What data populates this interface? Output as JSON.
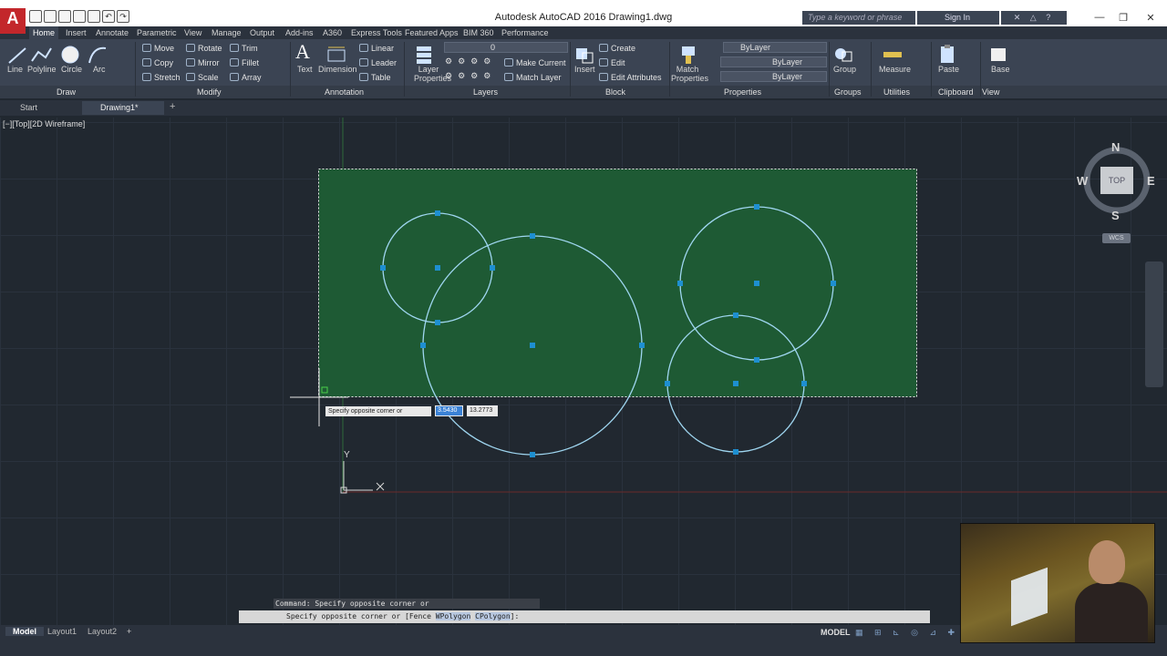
{
  "app": {
    "logo": "A",
    "title": "Autodesk AutoCAD 2016    Drawing1.dwg",
    "search_placeholder": "Type a keyword or phrase",
    "signin": "Sign In"
  },
  "menu_tabs": [
    "Home",
    "Insert",
    "Annotate",
    "Parametric",
    "View",
    "Manage",
    "Output",
    "Add-ins",
    "A360",
    "Express Tools",
    "Featured Apps",
    "BIM 360",
    "Performance"
  ],
  "ribbon": {
    "draw": {
      "title": "Draw",
      "tools": [
        "Line",
        "Polyline",
        "Circle",
        "Arc"
      ]
    },
    "modify": {
      "title": "Modify",
      "tools": [
        "Move",
        "Rotate",
        "Trim",
        "Copy",
        "Mirror",
        "Fillet",
        "Stretch",
        "Scale",
        "Array"
      ]
    },
    "annotation": {
      "title": "Annotation",
      "tools": [
        "Text",
        "Dimension",
        "Linear",
        "Leader",
        "Table"
      ]
    },
    "layers": {
      "title": "Layers",
      "big": "Layer Properties",
      "current_layer": "0",
      "tools": [
        "Make Current",
        "Match Layer"
      ]
    },
    "block": {
      "title": "Block",
      "big": "Insert",
      "tools": [
        "Create",
        "Edit",
        "Edit Attributes"
      ]
    },
    "properties": {
      "title": "Properties",
      "big": "Match Properties",
      "color": "ByLayer",
      "linetype": "ByLayer",
      "lineweight": "ByLayer"
    },
    "groups": {
      "title": "Groups",
      "big": "Group"
    },
    "utilities": {
      "title": "Utilities",
      "big": "Measure"
    },
    "clipboard": {
      "title": "Clipboard",
      "big": "Paste"
    },
    "view": {
      "title": "View",
      "big": "Base"
    }
  },
  "file_tabs": [
    "Start",
    "Drawing1*"
  ],
  "viewport_label": "[−][Top][2D Wireframe]",
  "viewcube": {
    "top": "TOP",
    "n": "N",
    "s": "S",
    "e": "E",
    "w": "W",
    "wcs": "WCS"
  },
  "tooltip": {
    "prompt": "Specify opposite corner or",
    "x_value": "3.5430",
    "y_value": "13.2773"
  },
  "command": {
    "history": "Command: Specify opposite corner or [Fence/WPolygon/CPolygon]:",
    "prompt_prefix": "Specify opposite corner or [",
    "options": [
      "Fence",
      "WPolygon",
      "CPolygon"
    ],
    "prompt_suffix": "]:"
  },
  "ucs": {
    "x": "X",
    "y": "Y"
  },
  "layout_tabs": [
    "Model",
    "Layout1",
    "Layout2"
  ],
  "status": {
    "model": "MODEL"
  },
  "colors": {
    "selection_fill": "#1e5a34",
    "circle_stroke": "#9fd6f0",
    "grip": "#1e8fd0",
    "accent_red": "#c3272b"
  }
}
